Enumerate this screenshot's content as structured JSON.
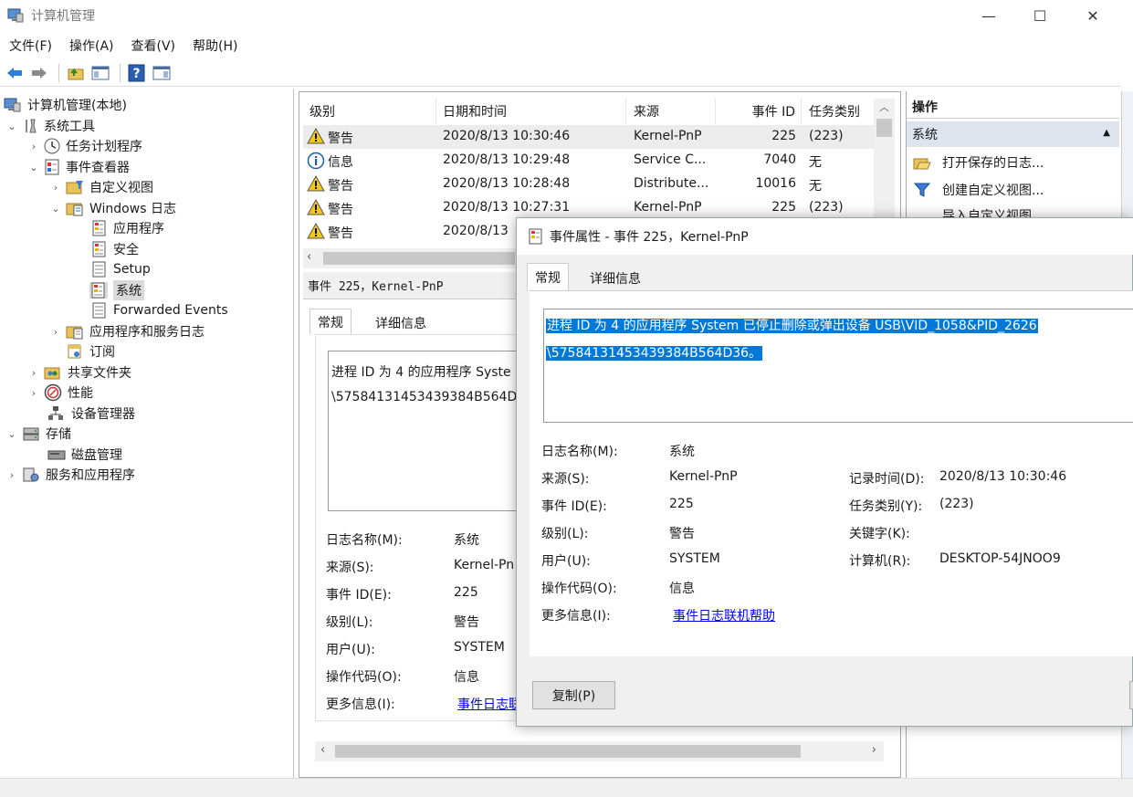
{
  "window": {
    "title": "计算机管理",
    "minimize": "—",
    "maximize": "☐",
    "close": "✕"
  },
  "menu": [
    "文件(F)",
    "操作(A)",
    "查看(V)",
    "帮助(H)"
  ],
  "tree": {
    "root": "计算机管理(本地)",
    "system_tools": "系统工具",
    "task_scheduler": "任务计划程序",
    "event_viewer": "事件查看器",
    "custom_views": "自定义视图",
    "windows_logs": "Windows 日志",
    "application": "应用程序",
    "security": "安全",
    "setup": "Setup",
    "system": "系统",
    "forwarded": "Forwarded Events",
    "app_service_logs": "应用程序和服务日志",
    "subscriptions": "订阅",
    "shared_folders": "共享文件夹",
    "performance": "性能",
    "device_manager": "设备管理器",
    "storage": "存储",
    "disk_mgmt": "磁盘管理",
    "services_apps": "服务和应用程序"
  },
  "list": {
    "headers": [
      "级别",
      "日期和时间",
      "来源",
      "事件 ID",
      "任务类别"
    ],
    "rows": [
      {
        "level": "警告",
        "date": "2020/8/13 10:30:46",
        "source": "Kernel-PnP",
        "id": "225",
        "task": "(223)",
        "type": "warn"
      },
      {
        "level": "信息",
        "date": "2020/8/13 10:29:48",
        "source": "Service C...",
        "id": "7040",
        "task": "无",
        "type": "info"
      },
      {
        "level": "警告",
        "date": "2020/8/13 10:28:48",
        "source": "Distribute...",
        "id": "10016",
        "task": "无",
        "type": "warn"
      },
      {
        "level": "警告",
        "date": "2020/8/13 10:27:31",
        "source": "Kernel-PnP",
        "id": "225",
        "task": "(223)",
        "type": "warn"
      },
      {
        "level": "警告",
        "date": "2020/8/13",
        "source": "",
        "id": "",
        "task": "",
        "type": "warn"
      }
    ]
  },
  "detail": {
    "header": "事件 225，Kernel-PnP",
    "tab_general": "常规",
    "tab_details": "详细信息",
    "msg_line1": "进程 ID 为 4 的应用程序 Syste",
    "msg_line2": "\\57584131453439384B564D",
    "labels": [
      "日志名称(M):",
      "来源(S):",
      "事件 ID(E):",
      "级别(L):",
      "用户(U):",
      "操作代码(O):",
      "更多信息(I):"
    ],
    "values": [
      "系统",
      "Kernel-Pn",
      "225",
      "警告",
      "SYSTEM",
      "信息"
    ],
    "link": "事件日志联"
  },
  "actions": {
    "header": "操作",
    "section": "系统",
    "items": [
      "打开保存的日志...",
      "创建自定义视图...",
      "导入自定义视图..."
    ]
  },
  "dialog": {
    "title": "事件属性 - 事件 225，Kernel-PnP",
    "tab_general": "常规",
    "tab_details": "详细信息",
    "message_line1": "进程 ID 为 4 的应用程序 System 已停止删除或弹出设备 USB\\VID_1058&PID_2626",
    "message_line2": "\\57584131453439384B564D36。",
    "log_name_label": "日志名称(M):",
    "log_name": "系统",
    "source_label": "来源(S):",
    "source": "Kernel-PnP",
    "logged_label": "记录时间(D):",
    "logged": "2020/8/13 10:30:46",
    "event_id_label": "事件 ID(E):",
    "event_id": "225",
    "task_label": "任务类别(Y):",
    "task": "(223)",
    "level_label": "级别(L):",
    "level": "警告",
    "keywords_label": "关键字(K):",
    "user_label": "用户(U):",
    "user": "SYSTEM",
    "computer_label": "计算机(R):",
    "computer": "DESKTOP-54JNOO9",
    "opcode_label": "操作代码(O):",
    "opcode": "信息",
    "more_info_label": "更多信息(I):",
    "more_info_link": "事件日志联机帮助",
    "copy_button": "复制(P)"
  },
  "colors": {
    "selection": "#0078d7",
    "link": "#0000ee",
    "warning": "#f2c811",
    "info": "#1e5aa8"
  }
}
